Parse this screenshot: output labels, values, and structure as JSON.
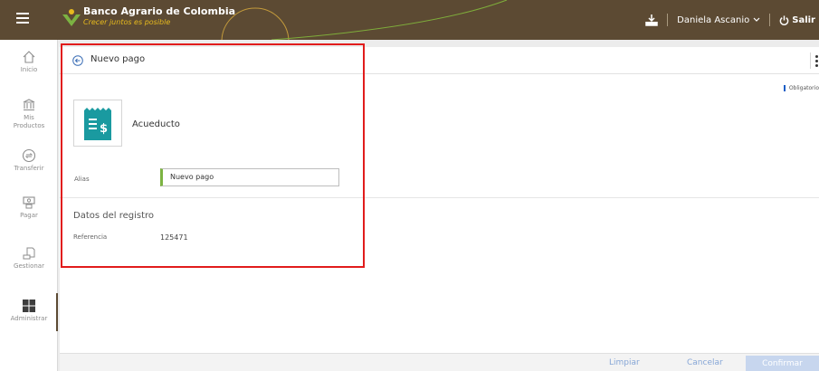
{
  "header": {
    "brand_name": "Banco Agrario de Colombia",
    "brand_tagline": "Crecer juntos es posible",
    "user_name": "Daniela Ascanio",
    "logout_label": "Salir",
    "colors": {
      "bar": "#5c4a33",
      "tagline": "#e6b91e"
    }
  },
  "sidebar": {
    "items": [
      {
        "label": "Inicio",
        "icon": "home-icon"
      },
      {
        "label": "Mis\nProductos",
        "icon": "bank-icon"
      },
      {
        "label": "Transferir",
        "icon": "transfer-icon"
      },
      {
        "label": "Pagar",
        "icon": "payment-icon"
      },
      {
        "label": "Gestionar",
        "icon": "manage-icon"
      },
      {
        "label": "Administrar",
        "icon": "grid-icon",
        "active": true
      }
    ]
  },
  "page": {
    "title": "Nuevo pago",
    "required_legend": "Obligatorio",
    "service": {
      "name": "Acueducto",
      "icon": "receipt-dollar-icon",
      "color": "#1a9aa0"
    },
    "alias": {
      "label": "Alias",
      "value": "Nuevo pago"
    },
    "section_title": "Datos del registro",
    "reference": {
      "label": "Referencia",
      "value": "125471"
    }
  },
  "footer": {
    "clear_label": "Limpiar",
    "cancel_label": "Cancelar",
    "confirm_label": "Confirmar"
  }
}
